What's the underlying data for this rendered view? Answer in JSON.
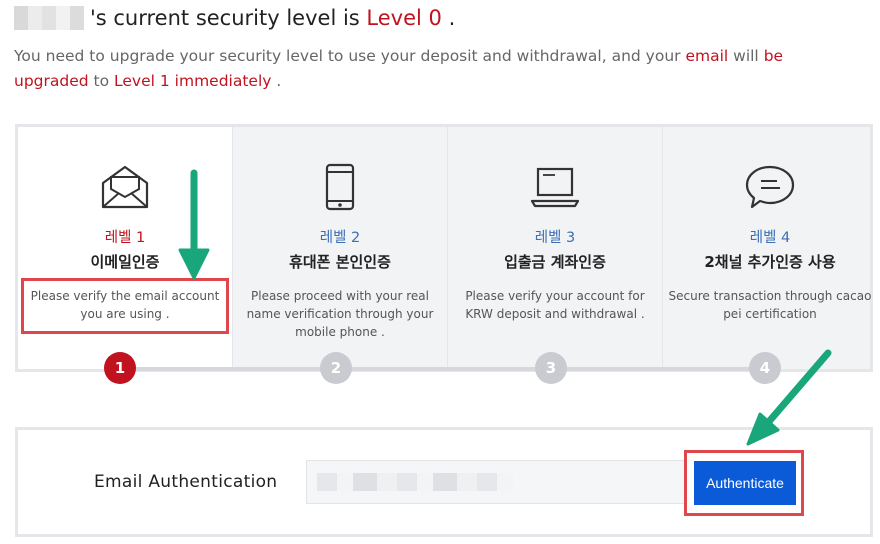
{
  "header": {
    "title_suffix": "'s current security level is",
    "level": "Level 0",
    "period": "."
  },
  "description": {
    "part1": "You need to upgrade your security level to use your deposit and withdrawal, and your",
    "email": "email",
    "will": "will",
    "be_upgraded": "be upgraded",
    "to": "to",
    "level1": "Level 1 immediately",
    "end": "."
  },
  "steps": [
    {
      "level": "레벨 1",
      "name": "이메일인증",
      "desc": "Please verify the email account you are using .",
      "icon": "envelope-icon",
      "number": "1"
    },
    {
      "level": "레벨 2",
      "name": "휴대폰 본인인증",
      "desc": "Please proceed with your real name verification through your mobile phone .",
      "icon": "mobile-phone-icon",
      "number": "2"
    },
    {
      "level": "레벨 3",
      "name": "입출금 계좌인증",
      "desc": "Please verify your account for KRW deposit and withdrawal .",
      "icon": "laptop-icon",
      "number": "3"
    },
    {
      "level": "레벨 4",
      "name": "2채널 추가인증 사용",
      "desc": "Secure transaction through cacao pei certification",
      "icon": "chat-bubble-icon",
      "number": "4"
    }
  ],
  "auth": {
    "label": "Email Authentication",
    "button": "Authenticate"
  },
  "colors": {
    "accent_red": "#c1121f",
    "level_blue": "#3b6fb6",
    "button_blue": "#0b5bd8",
    "annotation_green": "#19a67a",
    "annotation_red": "#e0474c"
  }
}
